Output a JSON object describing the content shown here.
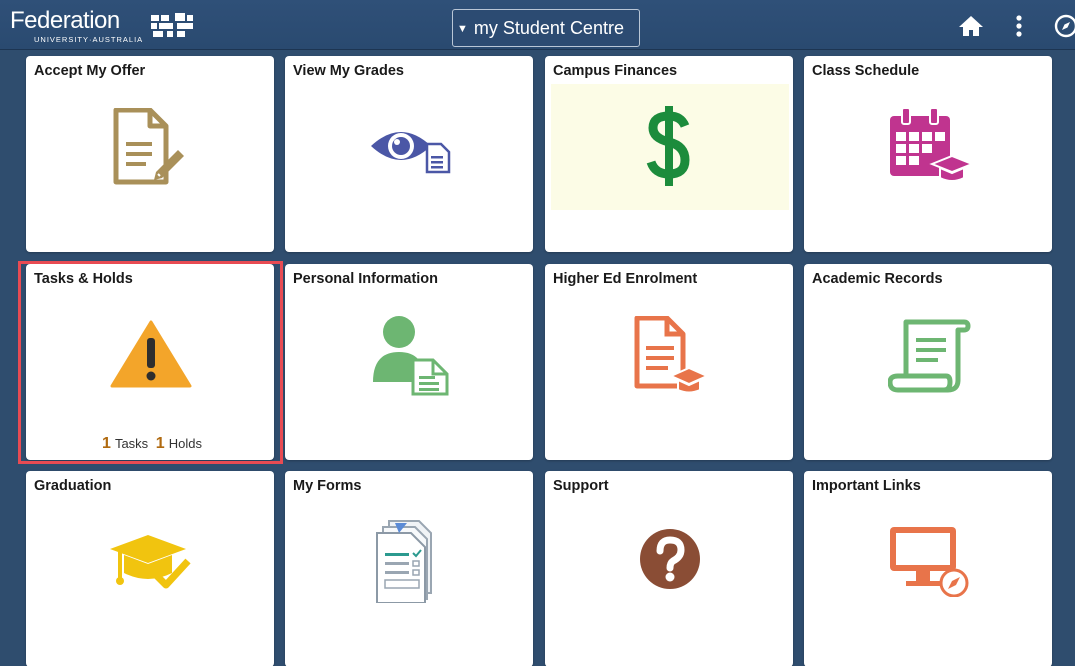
{
  "header": {
    "logo_main": "Federation",
    "logo_sub": "UNIVERSITY·AUSTRALIA",
    "title": "my Student Centre"
  },
  "icons": {
    "home": "home-icon",
    "menu": "more-vertical-icon",
    "nav": "compass-icon"
  },
  "tiles": [
    {
      "title": "Accept My Offer",
      "icon": "document-edit-icon"
    },
    {
      "title": "View My Grades",
      "icon": "eye-document-icon"
    },
    {
      "title": "Campus Finances",
      "icon": "dollar-icon"
    },
    {
      "title": "Class Schedule",
      "icon": "calendar-graduation-icon"
    },
    {
      "title": "Tasks & Holds",
      "icon": "warning-icon",
      "tasks_count": "1",
      "tasks_label": "Tasks",
      "holds_count": "1",
      "holds_label": "Holds"
    },
    {
      "title": "Personal Information",
      "icon": "person-document-icon"
    },
    {
      "title": "Higher Ed Enrolment",
      "icon": "document-graduation-icon"
    },
    {
      "title": "Academic Records",
      "icon": "scroll-icon"
    },
    {
      "title": "Graduation",
      "icon": "graduation-cap-check-icon"
    },
    {
      "title": "My Forms",
      "icon": "forms-checklist-icon"
    },
    {
      "title": "Support",
      "icon": "question-icon"
    },
    {
      "title": "Important Links",
      "icon": "monitor-compass-icon"
    }
  ],
  "colors": {
    "header_bg": "#2f5078",
    "page_bg": "#2f4d6e",
    "highlight": "#e84b53",
    "finance_green": "#1c8c3c",
    "finance_bg": "#fcfce6"
  }
}
